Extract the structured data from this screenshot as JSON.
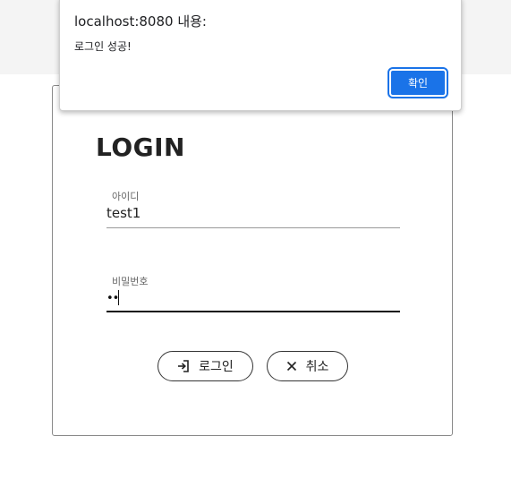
{
  "dialog": {
    "title": "localhost:8080 내용:",
    "message": "로그인 성공!",
    "ok_label": "확인",
    "accent_color": "#1a73e8"
  },
  "login": {
    "title": "LOGIN",
    "id_field": {
      "label": "아이디",
      "value": "test1"
    },
    "password_field": {
      "label": "비밀번호",
      "masked_value": "••"
    },
    "login_button": {
      "label": "로그인",
      "icon": "login-icon"
    },
    "cancel_button": {
      "label": "취소",
      "icon": "close-icon"
    }
  }
}
